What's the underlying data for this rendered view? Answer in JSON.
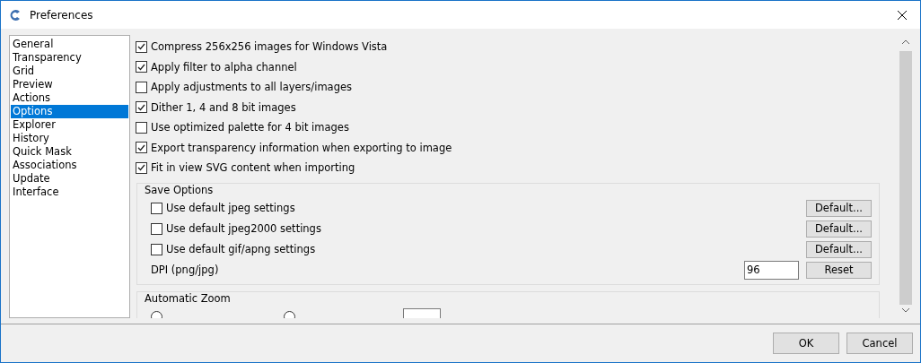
{
  "window": {
    "title": "Preferences"
  },
  "sidebar": {
    "items": [
      {
        "label": "General",
        "selected": false
      },
      {
        "label": "Transparency",
        "selected": false
      },
      {
        "label": "Grid",
        "selected": false
      },
      {
        "label": "Preview",
        "selected": false
      },
      {
        "label": "Actions",
        "selected": false
      },
      {
        "label": "Options",
        "selected": true
      },
      {
        "label": "Explorer",
        "selected": false
      },
      {
        "label": "History",
        "selected": false
      },
      {
        "label": "Quick Mask",
        "selected": false
      },
      {
        "label": "Associations",
        "selected": false
      },
      {
        "label": "Update",
        "selected": false
      },
      {
        "label": "Interface",
        "selected": false
      }
    ]
  },
  "options": [
    {
      "label": "Compress 256x256 images for Windows Vista",
      "checked": true
    },
    {
      "label": "Apply filter to alpha channel",
      "checked": true
    },
    {
      "label": "Apply adjustments to all layers/images",
      "checked": false
    },
    {
      "label": "Dither 1, 4 and 8 bit images",
      "checked": true
    },
    {
      "label": "Use optimized palette for 4 bit images",
      "checked": false
    },
    {
      "label": "Export transparency information when exporting to image",
      "checked": true
    },
    {
      "label": "Fit in view SVG content when importing",
      "checked": true
    }
  ],
  "save_options": {
    "title": "Save Options",
    "rows": [
      {
        "kind": "checkbox",
        "label": "Use default jpeg settings",
        "checked": false,
        "button": "Default..."
      },
      {
        "kind": "checkbox",
        "label": "Use default jpeg2000 settings",
        "checked": false,
        "button": "Default..."
      },
      {
        "kind": "checkbox",
        "label": "Use default gif/apng settings",
        "checked": false,
        "button": "Default..."
      },
      {
        "kind": "field",
        "label": "DPI (png/jpg)",
        "value": "96",
        "button": "Reset"
      }
    ]
  },
  "automatic_zoom": {
    "title": "Automatic Zoom",
    "radios": [
      {
        "selected": false
      },
      {
        "selected": false
      }
    ]
  },
  "buttons": [
    "OK",
    "Cancel"
  ]
}
